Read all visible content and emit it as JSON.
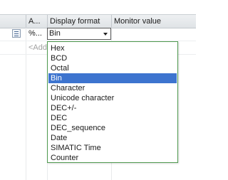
{
  "header": {
    "col_address": "A...",
    "col_display_format": "Display format",
    "col_monitor_value": "Monitor value"
  },
  "row": {
    "address": "%...",
    "display_format": "Bin"
  },
  "add_new_placeholder": "<Add",
  "dropdown": {
    "options": [
      "Hex",
      "BCD",
      "Octal",
      "Bin",
      "Character",
      "Unicode character",
      "DEC+/-",
      "DEC",
      "DEC_sequence",
      "Date",
      "SIMATIC Time",
      "Counter"
    ],
    "selected": "Bin"
  },
  "colors": {
    "selection": "#3d74cf",
    "dropdown_border": "#4f9a4f",
    "header_bg": "#dfe3e6"
  }
}
